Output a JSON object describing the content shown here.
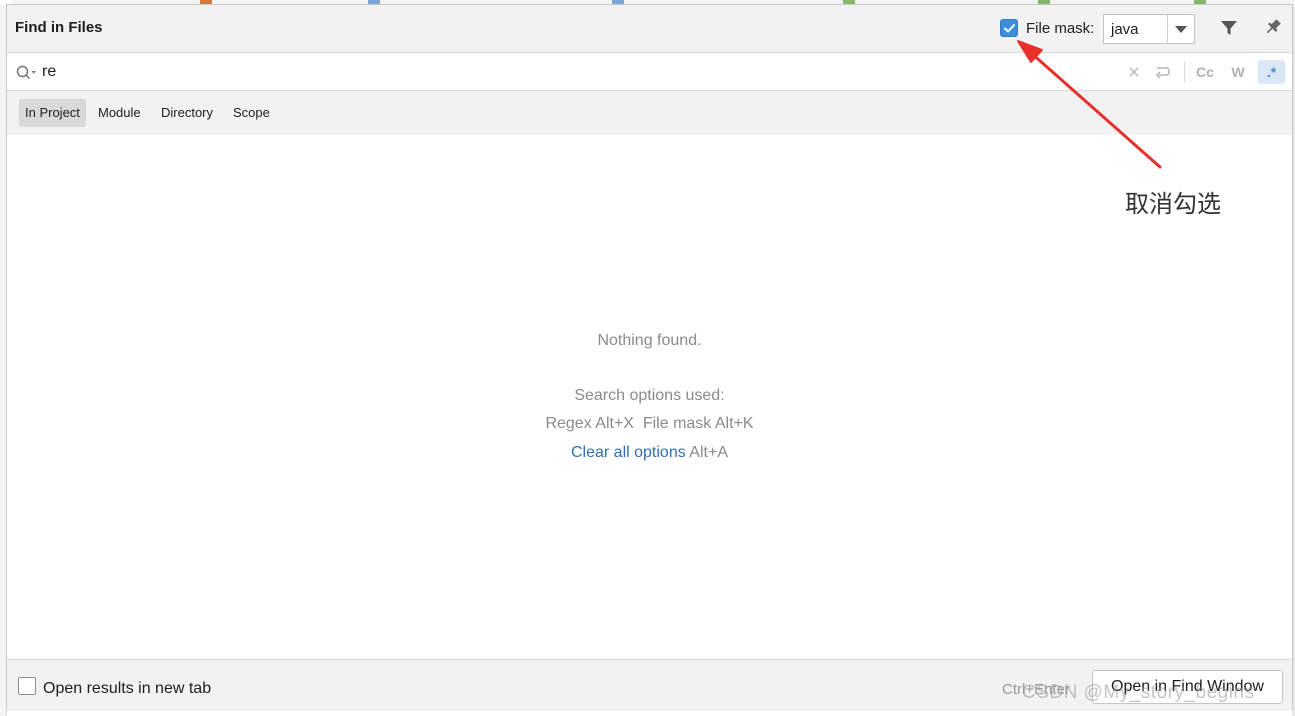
{
  "dialog": {
    "title": "Find in Files",
    "file_mask": {
      "checked": true,
      "label": "File mask:",
      "value": "java"
    }
  },
  "search": {
    "query": "re",
    "tools": {
      "match_case": "Cc",
      "words": "W",
      "regex": ".*"
    }
  },
  "scope": {
    "tabs": [
      "In Project",
      "Module",
      "Directory",
      "Scope"
    ],
    "active": "In Project"
  },
  "results": {
    "empty_message": "Nothing found.",
    "options_heading": "Search options used:",
    "options_used": "Regex Alt+X  File mask Alt+K",
    "clear_link": "Clear all options",
    "clear_shortcut": "Alt+A"
  },
  "footer": {
    "new_tab_label": "Open results in new tab",
    "new_tab_checked": false,
    "shortcut": "Ctrl+Enter",
    "open_button": "Open in Find Window"
  },
  "annotation": {
    "text": "取消勾选",
    "color": "#e8302a"
  },
  "watermark": "CSDN @My_story_begins",
  "colors": {
    "accent": "#3d8fd9",
    "link": "#2f6eb5",
    "header_bg": "#f2f2f2"
  }
}
